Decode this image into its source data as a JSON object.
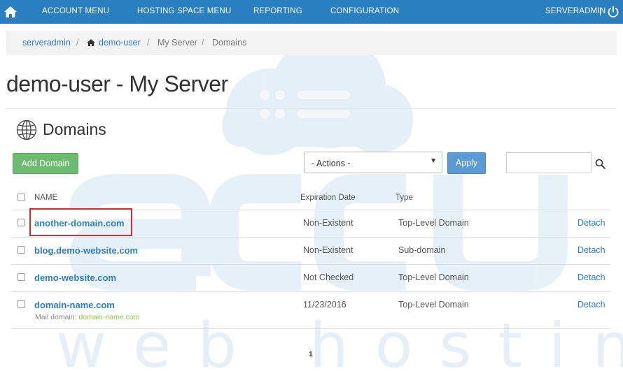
{
  "nav": {
    "items": [
      "ACCOUNT MENU",
      "HOSTING SPACE MENU",
      "REPORTING",
      "CONFIGURATION"
    ],
    "user": "SERVERADMIN",
    "separator": "|"
  },
  "breadcrumb": {
    "items": [
      "serveradmin",
      "demo-user",
      "My Server",
      "Domains"
    ],
    "separator": "/"
  },
  "page": {
    "title": "demo-user - My Server",
    "section": "Domains"
  },
  "toolbar": {
    "add_label": "Add Domain",
    "actions_value": "- Actions -",
    "apply_label": "Apply",
    "search_value": ""
  },
  "table": {
    "headers": [
      "NAME",
      "Expiration Date",
      "Type"
    ],
    "rows": [
      {
        "name": "another-domain.com",
        "expiration": "Non-Existent",
        "type": "Top-Level Domain",
        "action": "Detach"
      },
      {
        "name": "blog.demo-website.com",
        "expiration": "Non-Existent",
        "type": "Sub-domain",
        "action": "Detach"
      },
      {
        "name": "demo-website.com",
        "expiration": "Not Checked",
        "type": "Top-Level Domain",
        "action": "Detach"
      },
      {
        "name": "domain-name.com",
        "expiration": "11/23/2016",
        "type": "Top-Level Domain",
        "action": "Detach",
        "mail_label": "Mail domain:",
        "mail_domain": "domain-name.com"
      }
    ]
  },
  "pagination": {
    "current": "1"
  },
  "watermark": {
    "brand": "accu",
    "tagline": "web hosting"
  },
  "colors": {
    "nav_bg": "#2a7fc1",
    "link": "#2a7fc1",
    "add_button": "#6dbb6e",
    "apply_button": "#5b9bd5",
    "highlight": "#d32f2f",
    "mail_link": "#8cc34a"
  }
}
